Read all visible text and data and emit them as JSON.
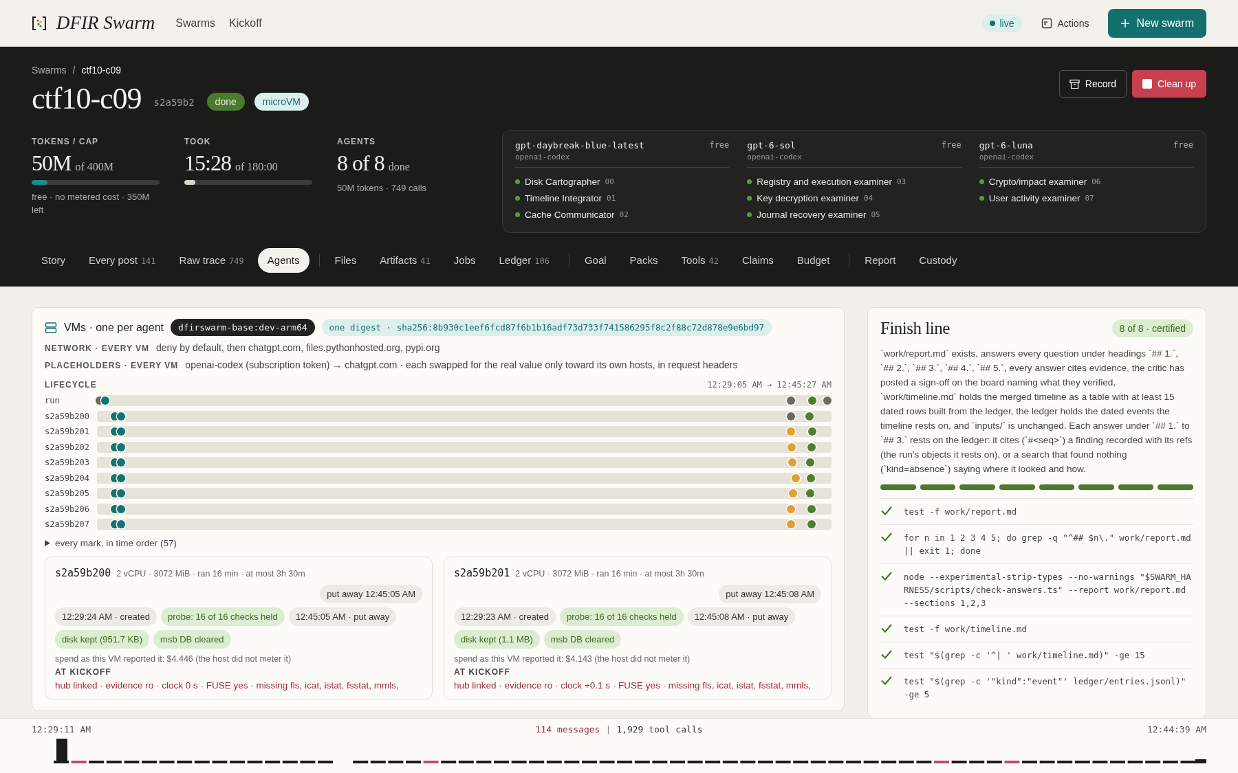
{
  "header": {
    "brand": "DFIR Swarm",
    "nav": [
      "Swarms",
      "Kickoff"
    ],
    "live": "live",
    "actions": "Actions",
    "new_button": "New swarm"
  },
  "breadcrumb": [
    "Swarms",
    "/",
    "ctf10-c09"
  ],
  "title": "ctf10-c09",
  "run_id": "s2a59b2",
  "badges": [
    {
      "label": "done",
      "kind": "status"
    },
    {
      "label": "microVM",
      "kind": "runtime"
    }
  ],
  "buttons": [
    {
      "label": "Record",
      "kind": "plain"
    },
    {
      "label": "Clean up",
      "kind": "danger"
    }
  ],
  "stats": [
    {
      "label": "TOKENS / CAP",
      "value": "50M",
      "unit": "of 400M",
      "level": 0.125,
      "kind": "budget",
      "note": "free · no metered cost · 350M left"
    },
    {
      "label": "TOOK",
      "value": "15:28",
      "unit": "of 180:00",
      "level": 0.086,
      "kind": "time"
    },
    {
      "label": "AGENTS",
      "value": "8 of 8",
      "unit": "done",
      "kind": "count",
      "note": "50M tokens · 749 calls"
    }
  ],
  "models": [
    {
      "name": "gpt-daybreak-blue-latest",
      "provider": "openai-codex",
      "price": "free",
      "agents": [
        {
          "name": "Disk Cartographer",
          "num": "00"
        },
        {
          "name": "Timeline Integrator",
          "num": "01"
        },
        {
          "name": "Cache Communicator",
          "num": "02"
        }
      ]
    },
    {
      "name": "gpt-6-sol",
      "provider": "openai-codex",
      "price": "free",
      "agents": [
        {
          "name": "Registry and execution examiner",
          "num": "03"
        },
        {
          "name": "Key decryption examiner",
          "num": "04"
        },
        {
          "name": "Journal recovery examiner",
          "num": "05"
        }
      ]
    },
    {
      "name": "gpt-6-luna",
      "provider": "openai-codex",
      "price": "free",
      "agents": [
        {
          "name": "Crypto/impact examiner",
          "num": "06"
        },
        {
          "name": "User activity examiner",
          "num": "07"
        }
      ]
    }
  ],
  "tab_groups": [
    [
      {
        "label": "Story",
        "selected": false
      },
      {
        "label": "Every post",
        "count": "141",
        "selected": false
      },
      {
        "label": "Raw trace",
        "count": "749",
        "selected": false
      },
      {
        "label": "Agents",
        "selected": true
      }
    ],
    [
      {
        "label": "Files",
        "selected": false
      },
      {
        "label": "Artifacts",
        "count": "41",
        "selected": false
      },
      {
        "label": "Jobs",
        "selected": false
      },
      {
        "label": "Ledger",
        "count": "106",
        "selected": false
      }
    ],
    [
      {
        "label": "Goal",
        "selected": false
      },
      {
        "label": "Packs",
        "selected": false
      },
      {
        "label": "Tools",
        "count": "42",
        "selected": false
      },
      {
        "label": "Claims",
        "selected": false
      },
      {
        "label": "Budget",
        "selected": false
      }
    ],
    [
      {
        "label": "Report",
        "selected": false
      },
      {
        "label": "Custody",
        "selected": false
      }
    ]
  ],
  "vms": {
    "title": "VMs · one per agent",
    "image": "dfirswarm-base:dev-arm64",
    "digest": "one digest · sha256:8b930c1eef6fcd87f6b1b16adf73d733f741586295f8c2f88c72d878e9e6bd97",
    "info": [
      {
        "label": "NETWORK · EVERY VM",
        "text": "deny by default, then chatgpt.com, files.pythonhosted.org, pypi.org"
      },
      {
        "label": "PLACEHOLDERS · EVERY VM",
        "text": "openai-codex (subscription token) → chatgpt.com · each swapped for the real value only toward its own hosts, in request headers"
      }
    ],
    "lifecycle_label": "LIFECYCLE",
    "range": "12:29:05 AM → 12:45:27 AM",
    "lifecycle": [
      {
        "name": "run",
        "marks": [
          {
            "level": 0.004,
            "color": "#6b6b66"
          },
          {
            "level": 0.011,
            "color": "#147373"
          },
          {
            "level": 0.945,
            "color": "#6b6b66"
          },
          {
            "level": 0.974,
            "color": "#4d7f2e"
          },
          {
            "level": 0.994,
            "color": "#6b6b66"
          }
        ]
      },
      {
        "name": "s2a59b200",
        "marks": [
          {
            "level": 0.024,
            "color": "#147373"
          },
          {
            "level": 0.033,
            "color": "#147373"
          },
          {
            "level": 0.945,
            "color": "#6b6b66"
          },
          {
            "level": 0.97,
            "color": "#4d7f2e"
          }
        ]
      },
      {
        "name": "s2a59b201",
        "marks": [
          {
            "level": 0.024,
            "color": "#147373"
          },
          {
            "level": 0.033,
            "color": "#147373"
          },
          {
            "level": 0.945,
            "color": "#e0a033"
          },
          {
            "level": 0.974,
            "color": "#4d7f2e"
          }
        ]
      },
      {
        "name": "s2a59b202",
        "marks": [
          {
            "level": 0.024,
            "color": "#147373"
          },
          {
            "level": 0.033,
            "color": "#147373"
          },
          {
            "level": 0.946,
            "color": "#e0a033"
          },
          {
            "level": 0.973,
            "color": "#4d7f2e"
          }
        ]
      },
      {
        "name": "s2a59b203",
        "marks": [
          {
            "level": 0.024,
            "color": "#147373"
          },
          {
            "level": 0.033,
            "color": "#147373"
          },
          {
            "level": 0.947,
            "color": "#e0a033"
          },
          {
            "level": 0.971,
            "color": "#4d7f2e"
          }
        ]
      },
      {
        "name": "s2a59b204",
        "marks": [
          {
            "level": 0.024,
            "color": "#147373"
          },
          {
            "level": 0.033,
            "color": "#147373"
          },
          {
            "level": 0.951,
            "color": "#e0a033"
          },
          {
            "level": 0.972,
            "color": "#4d7f2e"
          }
        ]
      },
      {
        "name": "s2a59b205",
        "marks": [
          {
            "level": 0.024,
            "color": "#147373"
          },
          {
            "level": 0.033,
            "color": "#147373"
          },
          {
            "level": 0.948,
            "color": "#e0a033"
          },
          {
            "level": 0.971,
            "color": "#4d7f2e"
          }
        ]
      },
      {
        "name": "s2a59b206",
        "marks": [
          {
            "level": 0.024,
            "color": "#147373"
          },
          {
            "level": 0.033,
            "color": "#147373"
          },
          {
            "level": 0.945,
            "color": "#e0a033"
          },
          {
            "level": 0.973,
            "color": "#4d7f2e"
          }
        ]
      },
      {
        "name": "s2a59b207",
        "marks": [
          {
            "level": 0.024,
            "color": "#147373"
          },
          {
            "level": 0.033,
            "color": "#147373"
          },
          {
            "level": 0.945,
            "color": "#e0a033"
          },
          {
            "level": 0.973,
            "color": "#4d7f2e"
          }
        ]
      }
    ],
    "every_mark": "every mark, in time order (57)",
    "cards": [
      {
        "name": "s2a59b200",
        "spec": "2 vCPU · 3072 MiB · ran 16 min · at most 3h 30m",
        "put_away": "put away 12:45:05 AM",
        "events": [
          {
            "text": "12:29:24 AM · created",
            "kind": "plain"
          },
          {
            "text": "probe: 16 of 16 checks held",
            "kind": "ok"
          },
          {
            "text": "12:45:05 AM · put away",
            "kind": "plain"
          },
          {
            "text": "disk kept (951.7 KB)",
            "kind": "ok"
          },
          {
            "text": "msb DB cleared",
            "kind": "ok"
          }
        ],
        "spend": "spend as this VM reported it: $4.446 (the host did not meter it)",
        "kickoff_label": "AT KICKOFF",
        "kickoff": "hub linked · evidence ro · clock 0 s · FUSE yes · missing fls, icat, istat, fsstat, mmls,"
      },
      {
        "name": "s2a59b201",
        "spec": "2 vCPU · 3072 MiB · ran 16 min · at most 3h 30m",
        "put_away": "put away 12:45:08 AM",
        "events": [
          {
            "text": "12:29:23 AM · created",
            "kind": "plain"
          },
          {
            "text": "probe: 16 of 16 checks held",
            "kind": "ok"
          },
          {
            "text": "12:45:08 AM · put away",
            "kind": "plain"
          },
          {
            "text": "disk kept (1.1 MB)",
            "kind": "ok"
          },
          {
            "text": "msb DB cleared",
            "kind": "ok"
          }
        ],
        "spend": "spend as this VM reported it: $4.143 (the host did not meter it)",
        "kickoff_label": "AT KICKOFF",
        "kickoff": "hub linked · evidence ro · clock +0.1 s · FUSE yes · missing fls, icat, istat, fsstat, mmls,"
      }
    ]
  },
  "finish": {
    "title": "Finish line",
    "badge": "8 of 8 · certified",
    "text": "`work/report.md` exists, answers every question under headings `## 1.`, `## 2.`, `## 3.`, `## 4.`, `## 5.`, every answer cites evidence, the critic has posted a sign-off on the board naming what they verified, `work/timeline.md` holds the merged timeline as a table with at least 15 dated rows built from the ledger, the ledger holds the dated events the timeline rests on, and `inputs/` is unchanged. Each answer under `## 1.` to `## 3.` rests on the ledger: it cites (`#<seq>`) a finding recorded with its refs (the run's objects it rests on), or a search that found nothing (`kind=absence`) saying where it looked and how.",
    "segments": [
      {
        "done": true
      },
      {
        "done": true
      },
      {
        "done": true
      },
      {
        "done": true
      },
      {
        "done": true
      },
      {
        "done": true
      },
      {
        "done": true
      },
      {
        "done": true
      }
    ],
    "checks": [
      {
        "command": "test -f work/report.md",
        "passed": true
      },
      {
        "command": "for n in 1 2 3 4 5; do grep -q \"^## $n\\.\" work/report.md || exit 1; done",
        "passed": true
      },
      {
        "command": "node --experimental-strip-types --no-warnings \"$SWARM_HARNESS/scripts/check-answers.ts\" --report work/report.md --sections 1,2,3",
        "passed": true
      },
      {
        "command": "test -f work/timeline.md",
        "passed": true
      },
      {
        "command": "test \"$(grep -c '^| ' work/timeline.md)\" -ge 15",
        "passed": true
      },
      {
        "command": "test \"$(grep -c '\"kind\":\"event\"' ledger/entries.jsonl)\" -ge 5",
        "passed": true
      }
    ]
  },
  "footer": {
    "start": "12:29:11 AM",
    "messages": "114 messages",
    "separator": "|",
    "tool_calls": "1,929 tool calls",
    "end": "12:44:39 AM"
  }
}
